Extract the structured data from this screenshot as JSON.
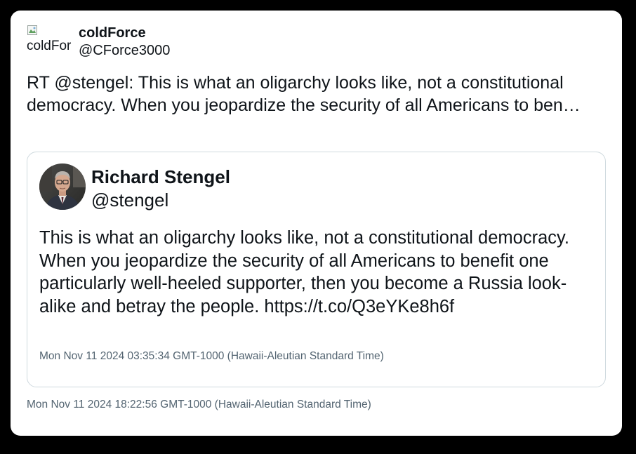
{
  "tweet": {
    "author": {
      "display_name": "coldForce",
      "handle": "@CForce3000",
      "avatar_alt": "coldForce"
    },
    "text": "RT @stengel: This is what an oligarchy looks like, not a constitutional democracy. When you jeopardize the security of all Americans to ben…",
    "timestamp": "Mon Nov 11 2024 18:22:56 GMT-1000 (Hawaii-Aleutian Standard Time)"
  },
  "quoted": {
    "author": {
      "display_name": "Richard Stengel",
      "handle": "@stengel",
      "avatar_icon": "user-photo"
    },
    "text": "This is what an oligarchy looks like, not a constitutional democracy. When you jeopardize the security of all Americans to benefit one particularly well-heeled supporter, then you become a Russia look-alike and betray the people. https://t.co/Q3eYKe8h6f",
    "timestamp": "Mon Nov 11 2024 03:35:34 GMT-1000 (Hawaii-Aleutian Standard Time)"
  },
  "colors": {
    "page_background": "#000000",
    "card_background": "#ffffff",
    "text": "#0f1419",
    "muted_text": "#536471",
    "border": "#cfd9de"
  }
}
